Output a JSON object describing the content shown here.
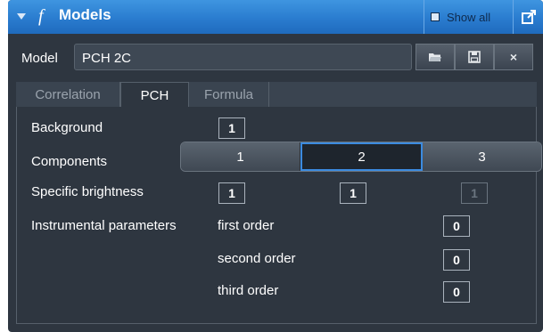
{
  "titlebar": {
    "title": "Models",
    "function_symbol": "f",
    "show_all_label": "Show all",
    "collapse_icon": "triangle-down-icon",
    "export_icon": "export-window-icon"
  },
  "model": {
    "label": "Model",
    "value": "PCH 2C",
    "buttons": [
      {
        "name": "open-folder-icon"
      },
      {
        "name": "save-icon"
      },
      {
        "name": "close-icon",
        "label": "×"
      }
    ]
  },
  "tabs": [
    {
      "label": "Correlation",
      "active": false
    },
    {
      "label": "PCH",
      "active": true
    },
    {
      "label": "Formula",
      "active": false
    }
  ],
  "pch": {
    "background": {
      "label": "Background",
      "value": "1"
    },
    "components": {
      "label": "Components",
      "options": [
        "1",
        "2",
        "3"
      ],
      "selected": "2"
    },
    "specific_brightness": {
      "label": "Specific brightness",
      "values": [
        "1",
        "1",
        "1"
      ]
    },
    "instrumental_parameters": {
      "label": "Instrumental parameters",
      "rows": [
        {
          "label": "first order",
          "value": "0"
        },
        {
          "label": "second order",
          "value": "0"
        },
        {
          "label": "third order",
          "value": "0"
        }
      ]
    }
  },
  "colors": {
    "titlebar": "#2a7ccf",
    "panel": "#2e3640",
    "selection": "#3b8be0"
  }
}
